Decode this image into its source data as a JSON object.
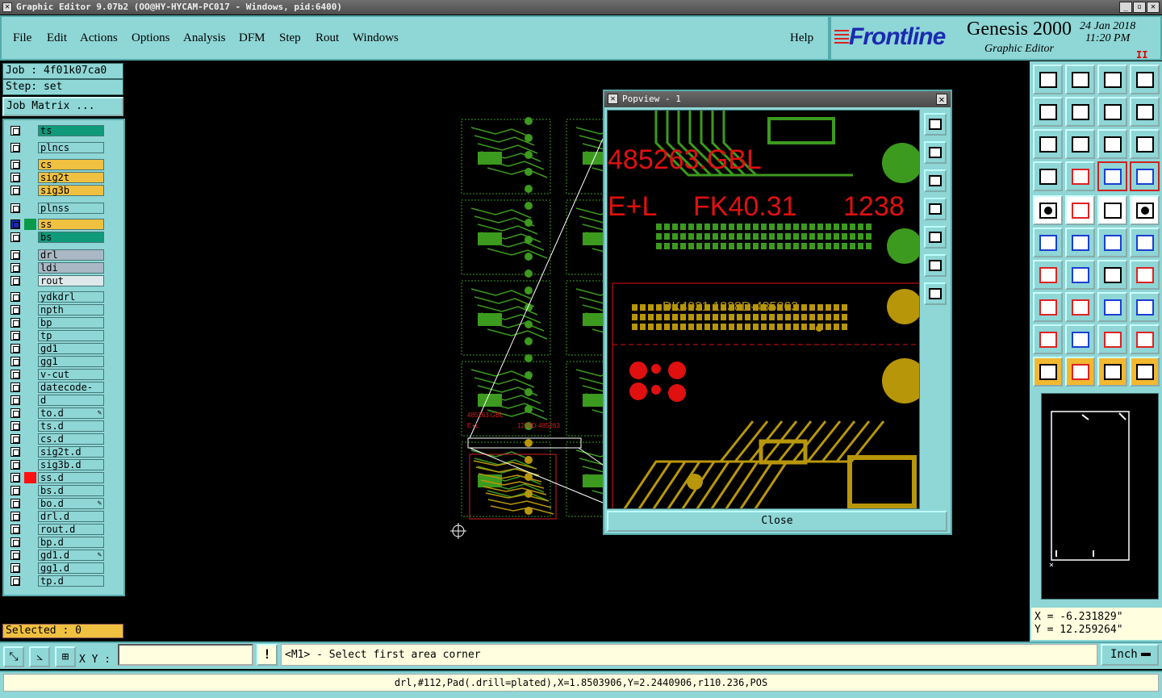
{
  "window": {
    "title": "Graphic Editor 9.07b2 (OO@HY-HYCAM-PC017 - Windows, pid:6400)",
    "buttons": [
      "_",
      "▫",
      "✕"
    ]
  },
  "menu": {
    "items": [
      "File",
      "Edit",
      "Actions",
      "Options",
      "Analysis",
      "DFM",
      "Step",
      "Rout",
      "Windows"
    ],
    "help": "Help"
  },
  "brand": {
    "logo": "Frontline",
    "product": "Genesis 2000",
    "subtitle": "Graphic Editor",
    "date": "24 Jan 2018",
    "time": "11:20 PM",
    "pause": "II"
  },
  "job": {
    "job_label": "Job : 4f01k07ca0",
    "step_label": "Step: set",
    "matrix_button": "Job Matrix ..."
  },
  "layers": [
    {
      "name": "ts",
      "color": "#0f9a7a",
      "row": 0
    },
    {
      "name": "plncs",
      "color": "#8fd6d6",
      "row": 1
    },
    {
      "name": "cs",
      "color": "#f0c040",
      "row": 2
    },
    {
      "name": "sig2t",
      "color": "#f0c040",
      "row": 3
    },
    {
      "name": "sig3b",
      "color": "#f0c040",
      "row": 4
    },
    {
      "name": "plnss",
      "color": "#8fd6d6",
      "row": 5
    },
    {
      "name": "ss",
      "color": "#f0c040",
      "row": 6,
      "active": true,
      "square": "#0a9a4a"
    },
    {
      "name": "bs",
      "color": "#0f9a7a",
      "row": 7
    },
    {
      "name": "drl",
      "color": "#a9b8c4",
      "row": 8
    },
    {
      "name": "ldi",
      "color": "#a9b8c4",
      "row": 9
    },
    {
      "name": "rout",
      "color": "#dfe8ea",
      "row": 10
    },
    {
      "name": "ydkdrl",
      "color": "#8fd6d6",
      "row": 11
    },
    {
      "name": "npth",
      "color": "#8fd6d6",
      "row": 12
    },
    {
      "name": "bp",
      "color": "#8fd6d6",
      "row": 13
    },
    {
      "name": "tp",
      "color": "#8fd6d6",
      "row": 14
    },
    {
      "name": "gd1",
      "color": "#8fd6d6",
      "row": 15
    },
    {
      "name": "gg1",
      "color": "#8fd6d6",
      "row": 16
    },
    {
      "name": "v-cut",
      "color": "#8fd6d6",
      "row": 17
    },
    {
      "name": "datecode-cs",
      "color": "#8fd6d6",
      "row": 18
    },
    {
      "name": "d",
      "color": "#8fd6d6",
      "row": 19
    },
    {
      "name": "to.d",
      "color": "#8fd6d6",
      "row": 20,
      "mark": "✎"
    },
    {
      "name": "ts.d",
      "color": "#8fd6d6",
      "row": 21
    },
    {
      "name": "cs.d",
      "color": "#8fd6d6",
      "row": 22
    },
    {
      "name": "sig2t.d",
      "color": "#8fd6d6",
      "row": 23
    },
    {
      "name": "sig3b.d",
      "color": "#8fd6d6",
      "row": 24
    },
    {
      "name": "ss.d",
      "color": "#8fd6d6",
      "row": 25,
      "square": "#ff1010"
    },
    {
      "name": "bs.d",
      "color": "#8fd6d6",
      "row": 26
    },
    {
      "name": "bo.d",
      "color": "#8fd6d6",
      "row": 27,
      "mark": "✎"
    },
    {
      "name": "drl.d",
      "color": "#8fd6d6",
      "row": 28
    },
    {
      "name": "rout.d",
      "color": "#8fd6d6",
      "row": 29
    },
    {
      "name": "bp.d",
      "color": "#8fd6d6",
      "row": 30
    },
    {
      "name": "gd1.d",
      "color": "#8fd6d6",
      "row": 31,
      "mark": "✎"
    },
    {
      "name": "gg1.d",
      "color": "#8fd6d6",
      "row": 32
    },
    {
      "name": "tp.d",
      "color": "#8fd6d6",
      "row": 33
    }
  ],
  "selected_label": "Selected : 0",
  "popview": {
    "title": "Popview - 1",
    "close_button": "Close",
    "board_texts": [
      "485263.GBL",
      "E+L",
      "FK40.31",
      "1238",
      "DK4031 1238D-485263"
    ]
  },
  "coords": {
    "x": "X = -6.231829\"",
    "y": "Y = 12.259264\""
  },
  "toolbar": {
    "xy_label": "X Y :",
    "xy_value": "",
    "bang": "!",
    "prompt": "<M1> - Select first area corner",
    "unit": "Inch"
  },
  "status_text": "drl,#112,Pad(.drill=plated),X=1.8503906,Y=2.2440906,r110.236,POS",
  "canvas_texts": [
    "485263.GBL",
    "E+L",
    "1238D-485263"
  ]
}
